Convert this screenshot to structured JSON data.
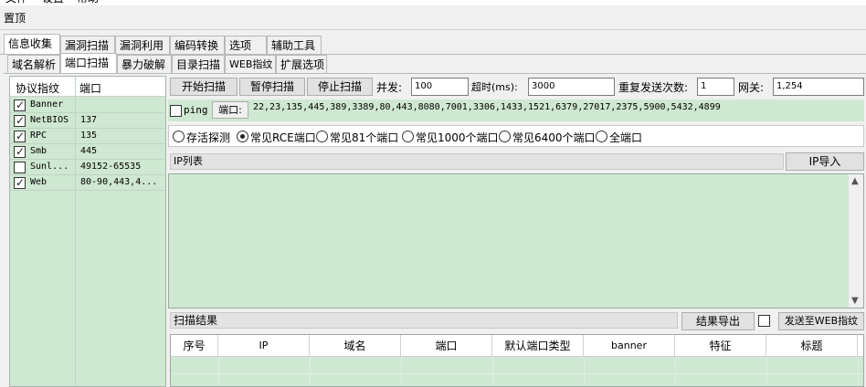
{
  "menu": [
    "文件",
    "设置",
    "帮助"
  ],
  "topmost_label": "置顶",
  "main_tabs": [
    "信息收集",
    "漏洞扫描",
    "漏洞利用",
    "编码转换",
    "选项",
    "辅助工具"
  ],
  "sub_tabs": [
    "域名解析",
    "端口扫描",
    "暴力破解",
    "目录扫描",
    "WEB指纹",
    "扩展选项"
  ],
  "port_list": {
    "headers": [
      "协议指纹",
      "端口"
    ],
    "rows": [
      {
        "name": "Banner",
        "ports": "",
        "checked": true
      },
      {
        "name": "NetBIOS",
        "ports": "137",
        "checked": true
      },
      {
        "name": "RPC",
        "ports": "135",
        "checked": true
      },
      {
        "name": "Smb",
        "ports": "445",
        "checked": true
      },
      {
        "name": "Sunl...",
        "ports": "49152-65535",
        "checked": false
      },
      {
        "name": "Web",
        "ports": "80-90,443,4...",
        "checked": true
      }
    ]
  },
  "toolbar": {
    "start": "开始扫描",
    "pause": "暂停扫描",
    "stop": "停止扫描",
    "concurrency_label": "并发:",
    "concurrency_value": "100",
    "timeout_label": "超时(ms):",
    "timeout_value": "3000",
    "retry_label": "重复发送次数:",
    "retry_value": "1",
    "gateway_label": "网关:",
    "gateway_value": "1,254"
  },
  "ping_label": "ping",
  "ports_label": "端口:",
  "ports_value": "22,23,135,445,389,3389,80,443,8080,7001,3306,1433,1521,6379,27017,2375,5900,5432,4899",
  "radio_options": [
    {
      "label": "存活探测",
      "selected": false
    },
    {
      "label": "常见RCE端口",
      "selected": true
    },
    {
      "label": "常见81个端口",
      "selected": false
    },
    {
      "label": "常见1000个端口",
      "selected": false
    },
    {
      "label": "常见6400个端口",
      "selected": false
    },
    {
      "label": "全端口",
      "selected": false
    }
  ],
  "ip_list_label": "IP列表",
  "ip_import": "IP导入",
  "scan_result_label": "扫描结果",
  "export_results": "结果导出",
  "send_to_web": "发送至WEB指纹",
  "result_columns": [
    "序号",
    "IP",
    "域名",
    "端口",
    "默认端口类型",
    "banner",
    "特征",
    "标题"
  ]
}
